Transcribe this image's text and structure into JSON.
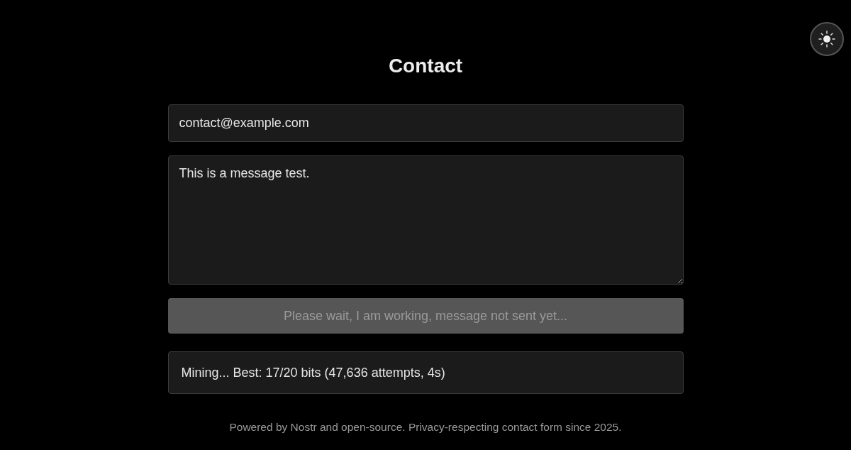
{
  "title": "Contact",
  "form": {
    "email": {
      "value": "contact@example.com"
    },
    "message": {
      "value": "This is a message test."
    },
    "submit_button": {
      "label": "Please wait, I am working, message not sent yet...",
      "disabled": true
    },
    "status": "Mining... Best: 17/20 bits (47,636 attempts, 4s)"
  },
  "footer": "Powered by Nostr and open-source. Privacy-respecting contact form since 2025."
}
